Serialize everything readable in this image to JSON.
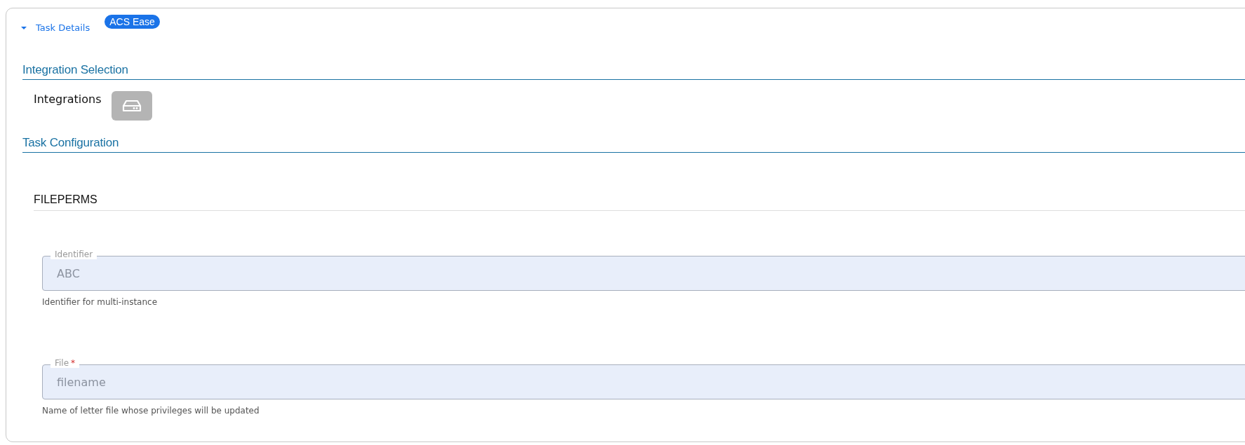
{
  "panel": {
    "title": "Task Details",
    "expanded": true,
    "badge": "ACS Ease"
  },
  "integration_selection": {
    "heading": "Integration Selection",
    "label": "Integrations"
  },
  "task_configuration": {
    "heading": "Task Configuration",
    "group": "FILEPERMS",
    "fields": [
      {
        "label": "Identifier",
        "value": "ABC",
        "helper": "Identifier for multi-instance"
      },
      {
        "label": "File",
        "required_mark": "*",
        "value": "filename",
        "helper": "Name of letter file whose privileges will be updated"
      }
    ]
  }
}
